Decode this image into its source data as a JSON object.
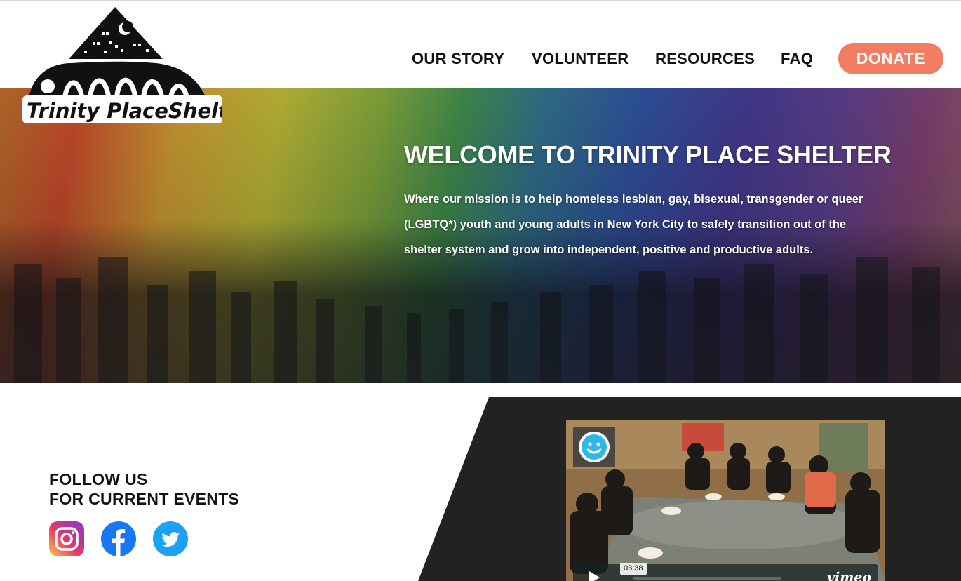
{
  "site": {
    "logo_text": "Trinity PlaceShelter"
  },
  "nav": {
    "items": [
      {
        "label": "OUR STORY"
      },
      {
        "label": "VOLUNTEER"
      },
      {
        "label": "RESOURCES"
      },
      {
        "label": "FAQ"
      }
    ],
    "donate_label": "DONATE"
  },
  "hero": {
    "title": "WELCOME TO TRINITY PLACE SHELTER",
    "text": "Where our mission is to help homeless lesbian, gay, bisexual, transgender or queer (LGBTQ*) youth and young adults in New York City to safely transition out of the shelter system and grow into independent, positive and productive adults."
  },
  "follow": {
    "line1": "FOLLOW US",
    "line2": "FOR CURRENT EVENTS",
    "icons": [
      "instagram-icon",
      "facebook-icon",
      "twitter-icon"
    ]
  },
  "video": {
    "duration": "03:38",
    "provider": "vimeo"
  },
  "colors": {
    "donate": "#f27d62",
    "dark_panel": "#222222",
    "facebook": "#1877f2",
    "twitter": "#1da1f2"
  }
}
